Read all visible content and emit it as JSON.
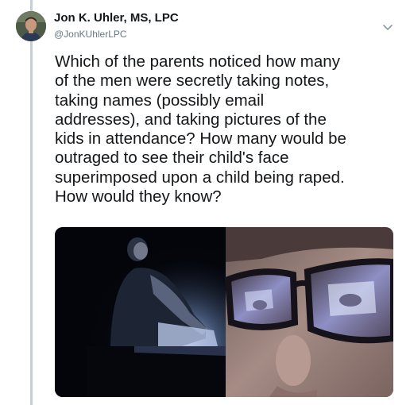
{
  "user": {
    "display_name": "Jon K. Uhler, MS, LPC",
    "handle": "@JonKUhlerLPC"
  },
  "tweet": {
    "lines": [
      "Which of the parents noticed how many",
      "of the men were secretly taking notes,",
      "taking names (possibly email",
      "addresses), and taking pictures of the",
      "kids in attendance? How many would be",
      "outraged to see their child's face",
      "superimposed upon a child being raped.",
      "How would they know?"
    ]
  },
  "icons": {
    "more": "chevron-down-icon",
    "avatar": "avatar"
  },
  "colors": {
    "thread_line": "#c4cfd6",
    "name": "#14171a",
    "handle": "#657786"
  }
}
